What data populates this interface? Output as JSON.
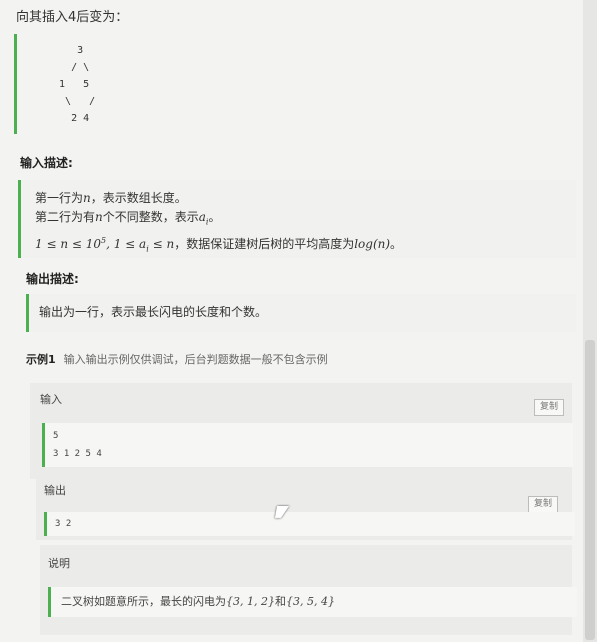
{
  "intro_text": "向其插入4后变为：",
  "tree_lines": [
    "     3",
    "    / \\",
    "  1   5",
    "   \\   /",
    "    2 4"
  ],
  "input_desc": {
    "title": "输入描述:",
    "line1_a": "第一行为",
    "line1_var": "n",
    "line1_b": "，表示数组长度。",
    "line2_a": "第二行为有",
    "line2_var": "n",
    "line2_b": "个不同整数，表示",
    "line2_var2": "a",
    "line2_sub": "i",
    "line2_c": "。",
    "line3_math": "1 ≤ n ≤ 10",
    "line3_sup": "5",
    "line3_math2": ", 1 ≤ a",
    "line3_sub": "i",
    "line3_math3": " ≤ n",
    "line3_text": "，数据保证建树后树的平均高度为",
    "line3_log": "log(n)",
    "line3_end": "。"
  },
  "output_desc": {
    "title": "输出描述:",
    "text": "输出为一行，表示最长闪电的长度和个数。"
  },
  "example": {
    "label": "示例1",
    "note": "输入输出示例仅供调试，后台判题数据一般不包含示例",
    "input_label": "输入",
    "input_lines": [
      "5",
      "3 1 2 5 4"
    ],
    "output_label": "输出",
    "output_lines": [
      "3 2"
    ],
    "copy_label": "复制",
    "explain_label": "说明",
    "explain_a": "二叉树如题意所示，最长的闪电为",
    "explain_set1": "{3, 1, 2}",
    "explain_mid": "和",
    "explain_set2": "{3, 5, 4}"
  },
  "colors": {
    "accent_green": "#4caf50",
    "background": "#f3f3f1"
  }
}
